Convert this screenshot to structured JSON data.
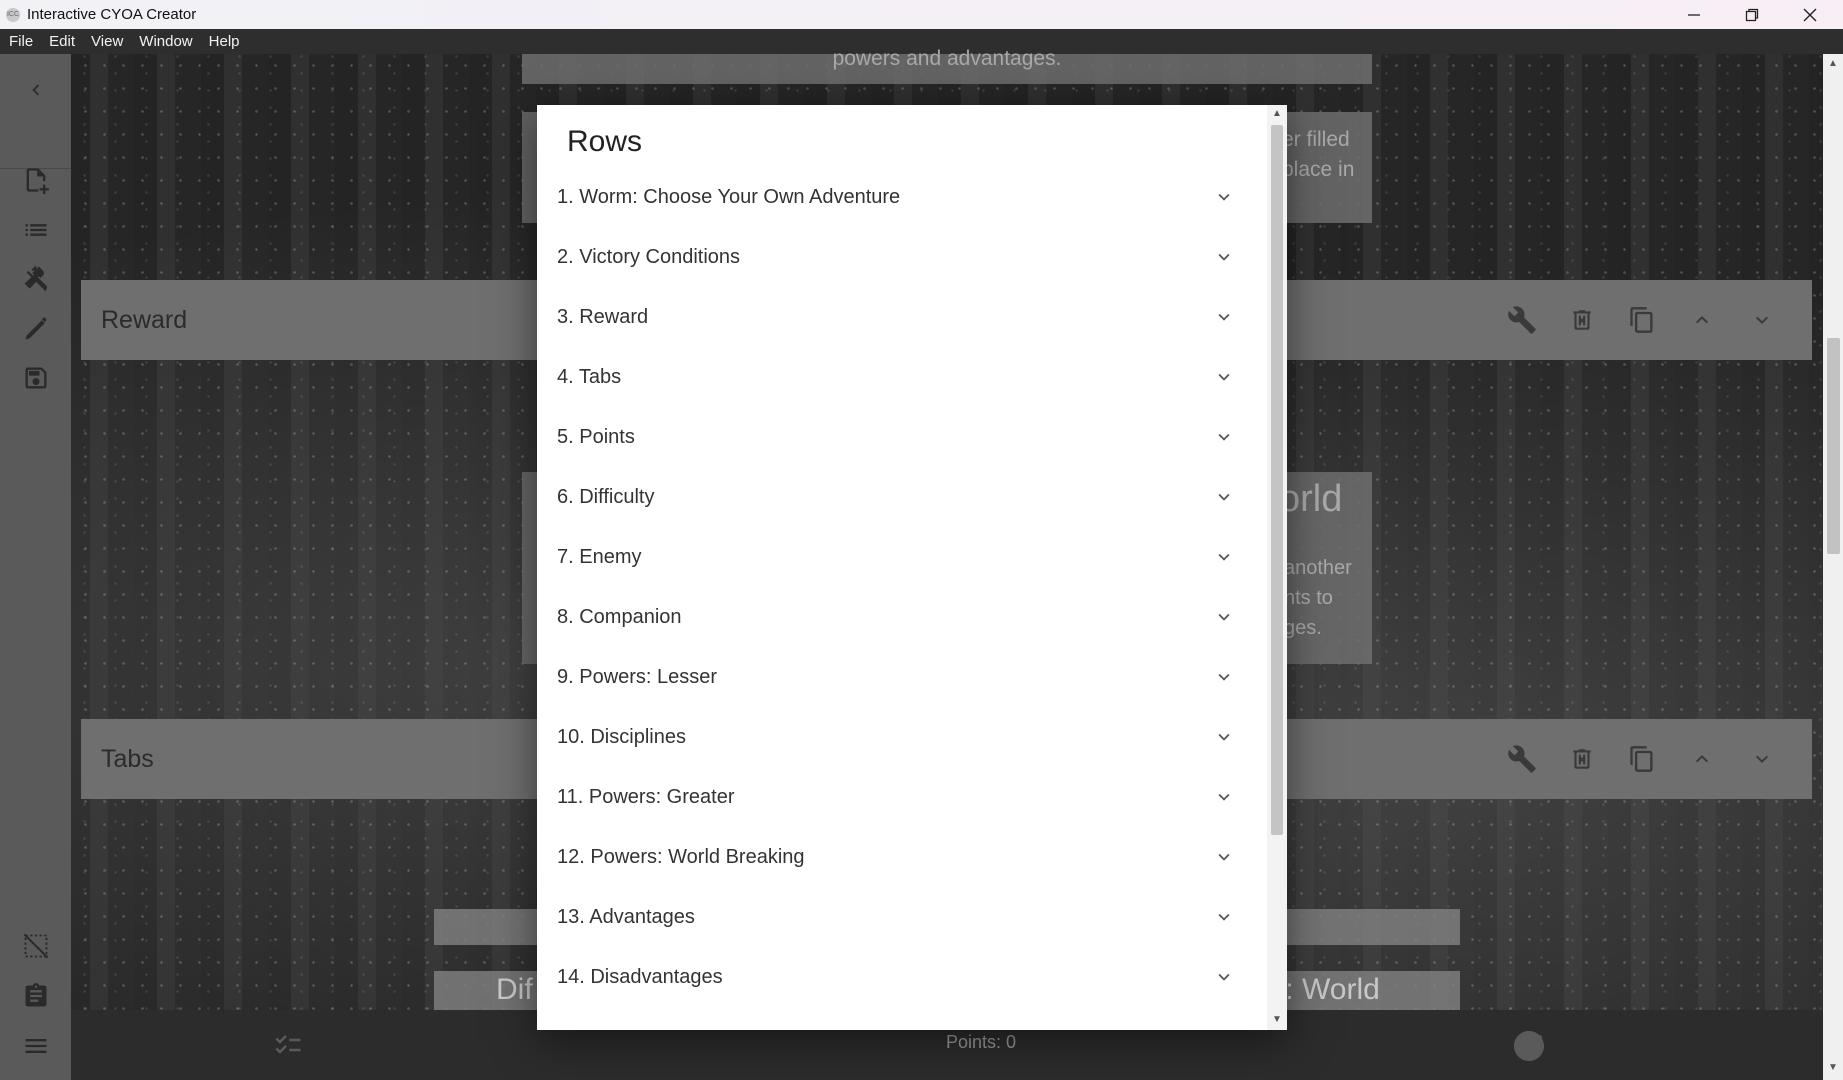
{
  "window": {
    "title": "Interactive CYOA Creator",
    "app_icon_text": "ICC"
  },
  "menu": [
    "File",
    "Edit",
    "View",
    "Window",
    "Help"
  ],
  "background": {
    "card_top_text": "powers and advantages.",
    "card_right_1": "er filled",
    "card_right_2": "place in",
    "card_right_title": "orld",
    "card_right_text_1": "another",
    "card_right_text_2": "nts to",
    "card_right_text_3": "ges.",
    "bottom_text_left": "Dif",
    "bottom_text_right": "wers: World"
  },
  "rows_bg": [
    {
      "title": "Reward"
    },
    {
      "title": "Tabs"
    }
  ],
  "bottom_bar": {
    "points": "Points: 0"
  },
  "dialog": {
    "title": "Rows",
    "items": [
      "1. Worm: Choose Your Own Adventure",
      "2. Victory Conditions",
      "3. Reward",
      "4. Tabs",
      "5. Points",
      "6. Difficulty",
      "7. Enemy",
      "8. Companion",
      "9. Powers: Lesser",
      "10. Disciplines",
      "11. Powers: Greater",
      "12. Powers: World Breaking",
      "13. Advantages",
      "14. Disadvantages"
    ]
  },
  "icons": {
    "rail": [
      "chevron-left-icon",
      "new-file-icon",
      "list-icon",
      "tools-icon",
      "brush-icon",
      "save-icon",
      "grid-off-icon",
      "clipboard-icon",
      "menu-icon"
    ],
    "row_actions": [
      "wrench-icon",
      "delete-icon",
      "copy-icon",
      "chevron-up-icon",
      "chevron-down-icon"
    ]
  }
}
